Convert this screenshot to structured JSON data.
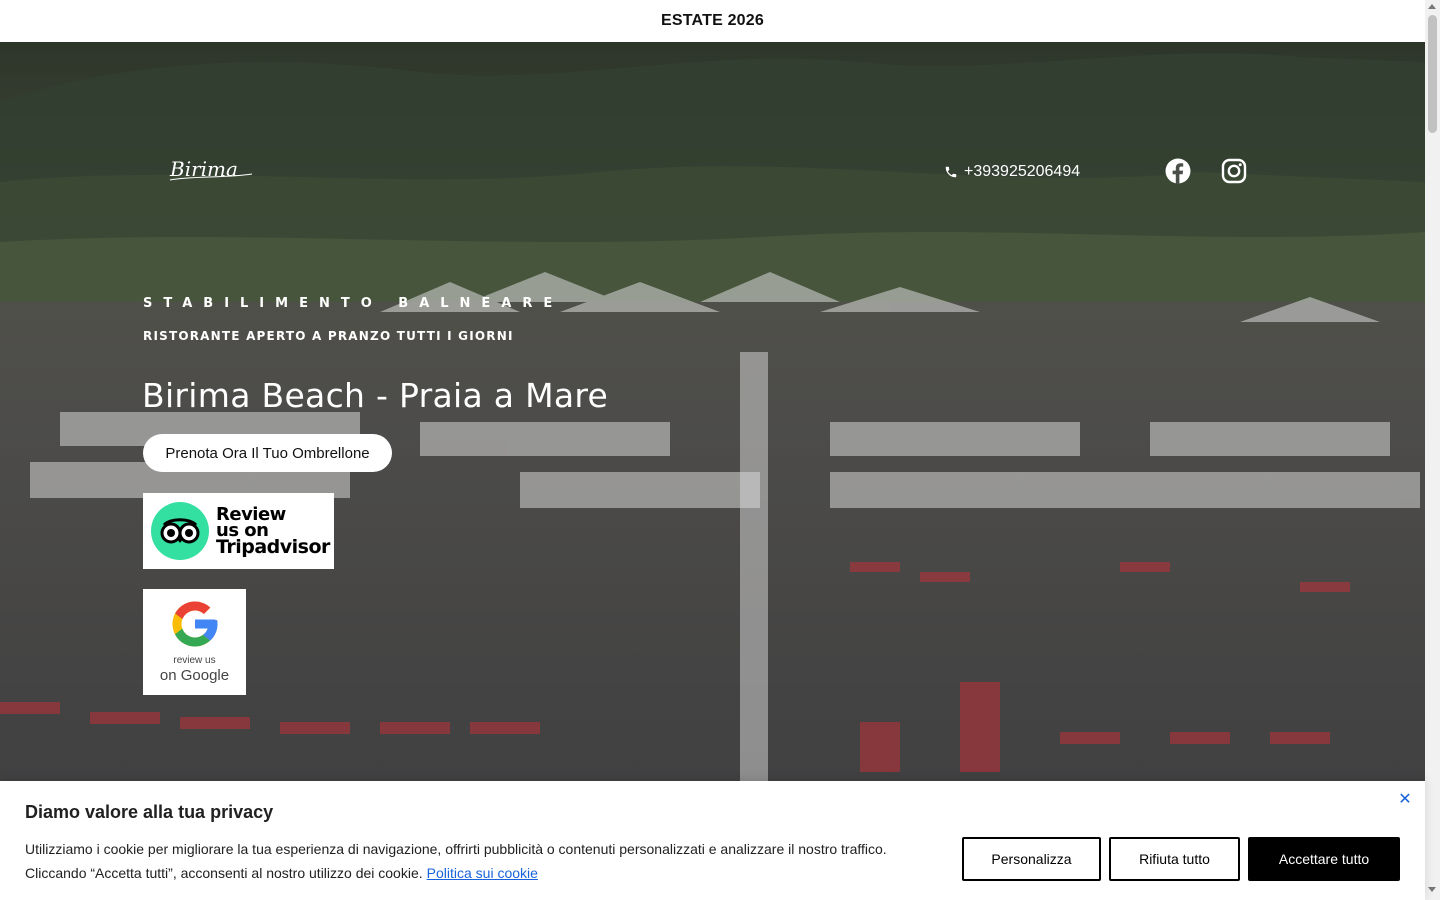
{
  "topbar": {
    "text": "ESTATE 2026"
  },
  "header": {
    "logo_text": "Birima",
    "phone": "+393925206494",
    "social": [
      {
        "name": "facebook-icon"
      },
      {
        "name": "instagram-icon"
      }
    ]
  },
  "hero": {
    "subtitle": "STABILIMENTO BALNEARE",
    "tagline": "RISTORANTE APERTO A PRANZO TUTTI I GIORNI",
    "title": "Birima Beach - Praia a Mare",
    "cta_label": "Prenota Ora Il Tuo Ombrellone"
  },
  "badges": {
    "tripadvisor": {
      "line1": "Review",
      "line2": "us on",
      "line3": "Tripadvisor"
    },
    "google": {
      "line1": "review us",
      "line2": "on Google"
    }
  },
  "cookie": {
    "title": "Diamo valore alla tua privacy",
    "body_line1": "Utilizziamo i cookie per migliorare la tua esperienza di navigazione, offrirti pubblicità o contenuti personalizzati e analizzare il nostro traffico.",
    "body_line2": "Cliccando “Accetta tutti”, acconsenti al nostro utilizzo dei cookie.",
    "policy_link": "Politica sui cookie",
    "btn_customize": "Personalizza",
    "btn_reject": "Rifiuta tutto",
    "btn_accept": "Accettare tutto",
    "close_symbol": "✕"
  },
  "colors": {
    "accent_link": "#1863dc",
    "tripadvisor_green": "#34e0a1",
    "google_blue": "#4285f4",
    "google_red": "#ea4335",
    "google_yellow": "#fbbc05",
    "google_green": "#34a853"
  }
}
